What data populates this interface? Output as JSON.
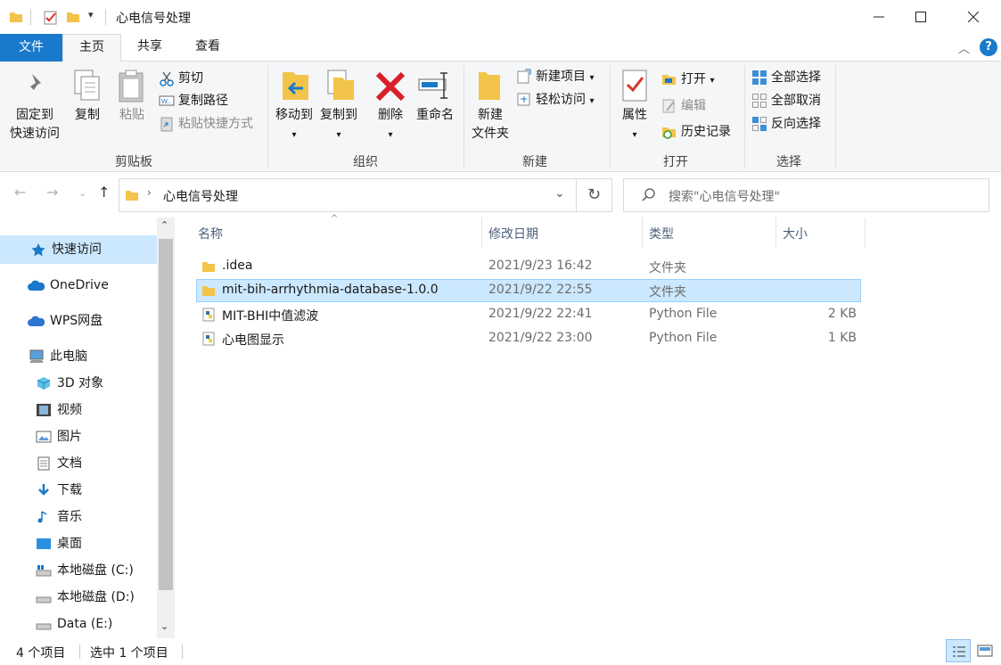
{
  "window": {
    "title": "心电信号处理"
  },
  "tabs": [
    "文件",
    "主页",
    "共享",
    "查看"
  ],
  "ribbon": {
    "clipboard": {
      "pin_label_1": "固定到",
      "pin_label_2": "快速访问",
      "copy_label": "复制",
      "paste_label": "粘贴",
      "cut_label": "剪切",
      "copy_path_label": "复制路径",
      "paste_shortcut_label": "粘贴快捷方式",
      "group_label": "剪贴板"
    },
    "organize": {
      "move_to_label": "移动到",
      "copy_to_label": "复制到",
      "delete_label": "删除",
      "rename_label": "重命名",
      "group_label": "组织"
    },
    "new": {
      "new_folder_label_1": "新建",
      "new_folder_label_2": "文件夹",
      "new_item_label": "新建项目",
      "easy_access_label": "轻松访问",
      "group_label": "新建"
    },
    "open": {
      "properties_label": "属性",
      "open_label": "打开",
      "edit_label": "编辑",
      "history_label": "历史记录",
      "group_label": "打开"
    },
    "select": {
      "select_all_label": "全部选择",
      "select_none_label": "全部取消",
      "invert_label": "反向选择",
      "group_label": "选择"
    }
  },
  "address": {
    "path": "心电信号处理",
    "search_placeholder": "搜索\"心电信号处理\""
  },
  "sidebar": {
    "items": [
      {
        "label": "快速访问",
        "icon": "star-icon"
      },
      {
        "label": "OneDrive",
        "icon": "cloud-icon"
      },
      {
        "label": "WPS网盘",
        "icon": "cloud-icon"
      },
      {
        "label": "此电脑",
        "icon": "computer-icon"
      },
      {
        "label": "3D 对象",
        "icon": "cube-icon"
      },
      {
        "label": "视频",
        "icon": "film-icon"
      },
      {
        "label": "图片",
        "icon": "picture-icon"
      },
      {
        "label": "文档",
        "icon": "document-icon"
      },
      {
        "label": "下载",
        "icon": "download-icon"
      },
      {
        "label": "音乐",
        "icon": "music-icon"
      },
      {
        "label": "桌面",
        "icon": "desktop-icon"
      },
      {
        "label": "本地磁盘 (C:)",
        "icon": "drive-icon"
      },
      {
        "label": "本地磁盘 (D:)",
        "icon": "drive-icon"
      },
      {
        "label": "Data (E:)",
        "icon": "drive-icon"
      }
    ]
  },
  "columns": [
    "名称",
    "修改日期",
    "类型",
    "大小"
  ],
  "files": [
    {
      "name": ".idea",
      "date": "2021/9/23 16:42",
      "type": "文件夹",
      "size": "",
      "kind": "folder"
    },
    {
      "name": "mit-bih-arrhythmia-database-1.0.0",
      "date": "2021/9/22 22:55",
      "type": "文件夹",
      "size": "",
      "kind": "folder"
    },
    {
      "name": "MIT-BHI中值滤波",
      "date": "2021/9/22 22:41",
      "type": "Python File",
      "size": "2 KB",
      "kind": "python"
    },
    {
      "name": "心电图显示",
      "date": "2021/9/22 23:00",
      "type": "Python File",
      "size": "1 KB",
      "kind": "python"
    }
  ],
  "status": {
    "count": "4 个项目",
    "selected": "选中 1 个项目"
  }
}
